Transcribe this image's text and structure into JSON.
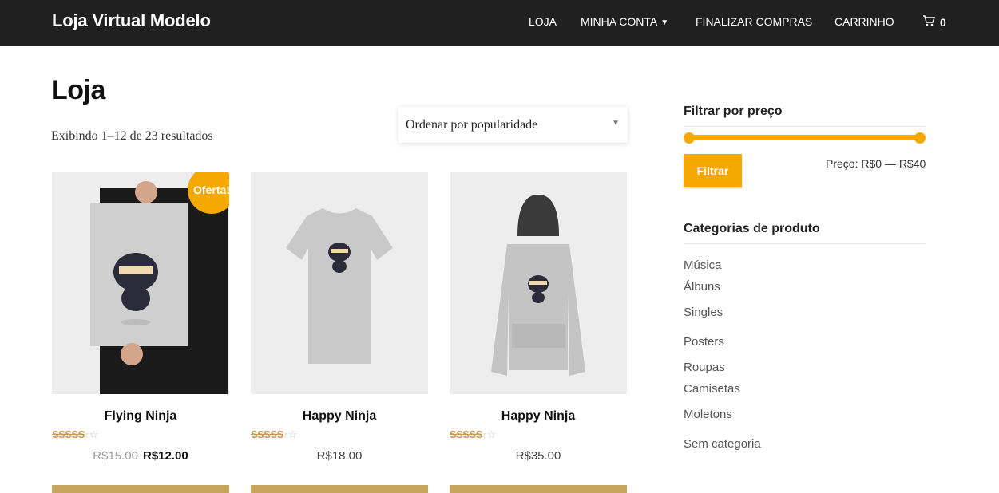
{
  "header": {
    "brand": "Loja Virtual Modelo",
    "nav": [
      "LOJA",
      "MINHA CONTA",
      "FINALIZAR COMPRAS",
      "CARRINHO"
    ],
    "cart_count": "0"
  },
  "main": {
    "title": "Loja",
    "result_count": "Exibindo 1–12 de 23 resultados",
    "orderby_selected": "Ordenar por popularidade"
  },
  "products": [
    {
      "name": "Flying Ninja",
      "old_price": "R$15.00",
      "price": "R$12.00",
      "badge": "Oferta!",
      "rating": 0.0
    },
    {
      "name": "Happy Ninja",
      "price": "R$18.00",
      "rating": 0.0
    },
    {
      "name": "Happy Ninja",
      "price": "R$35.00",
      "rating": 0.0
    }
  ],
  "sidebar": {
    "price_filter_title": "Filtrar por preço",
    "filter_button": "Filtrar",
    "price_range": "Preço: R$0 — R$40",
    "categories_title": "Categorias de produto",
    "categories": [
      "Música",
      "Álbuns",
      "Singles",
      "Posters",
      "Roupas",
      "Camisetas",
      "Moletons",
      "Sem categoria"
    ]
  },
  "colors": {
    "accent": "#f5a900",
    "topbar": "#202020",
    "button_bar": "#c6a55d"
  }
}
